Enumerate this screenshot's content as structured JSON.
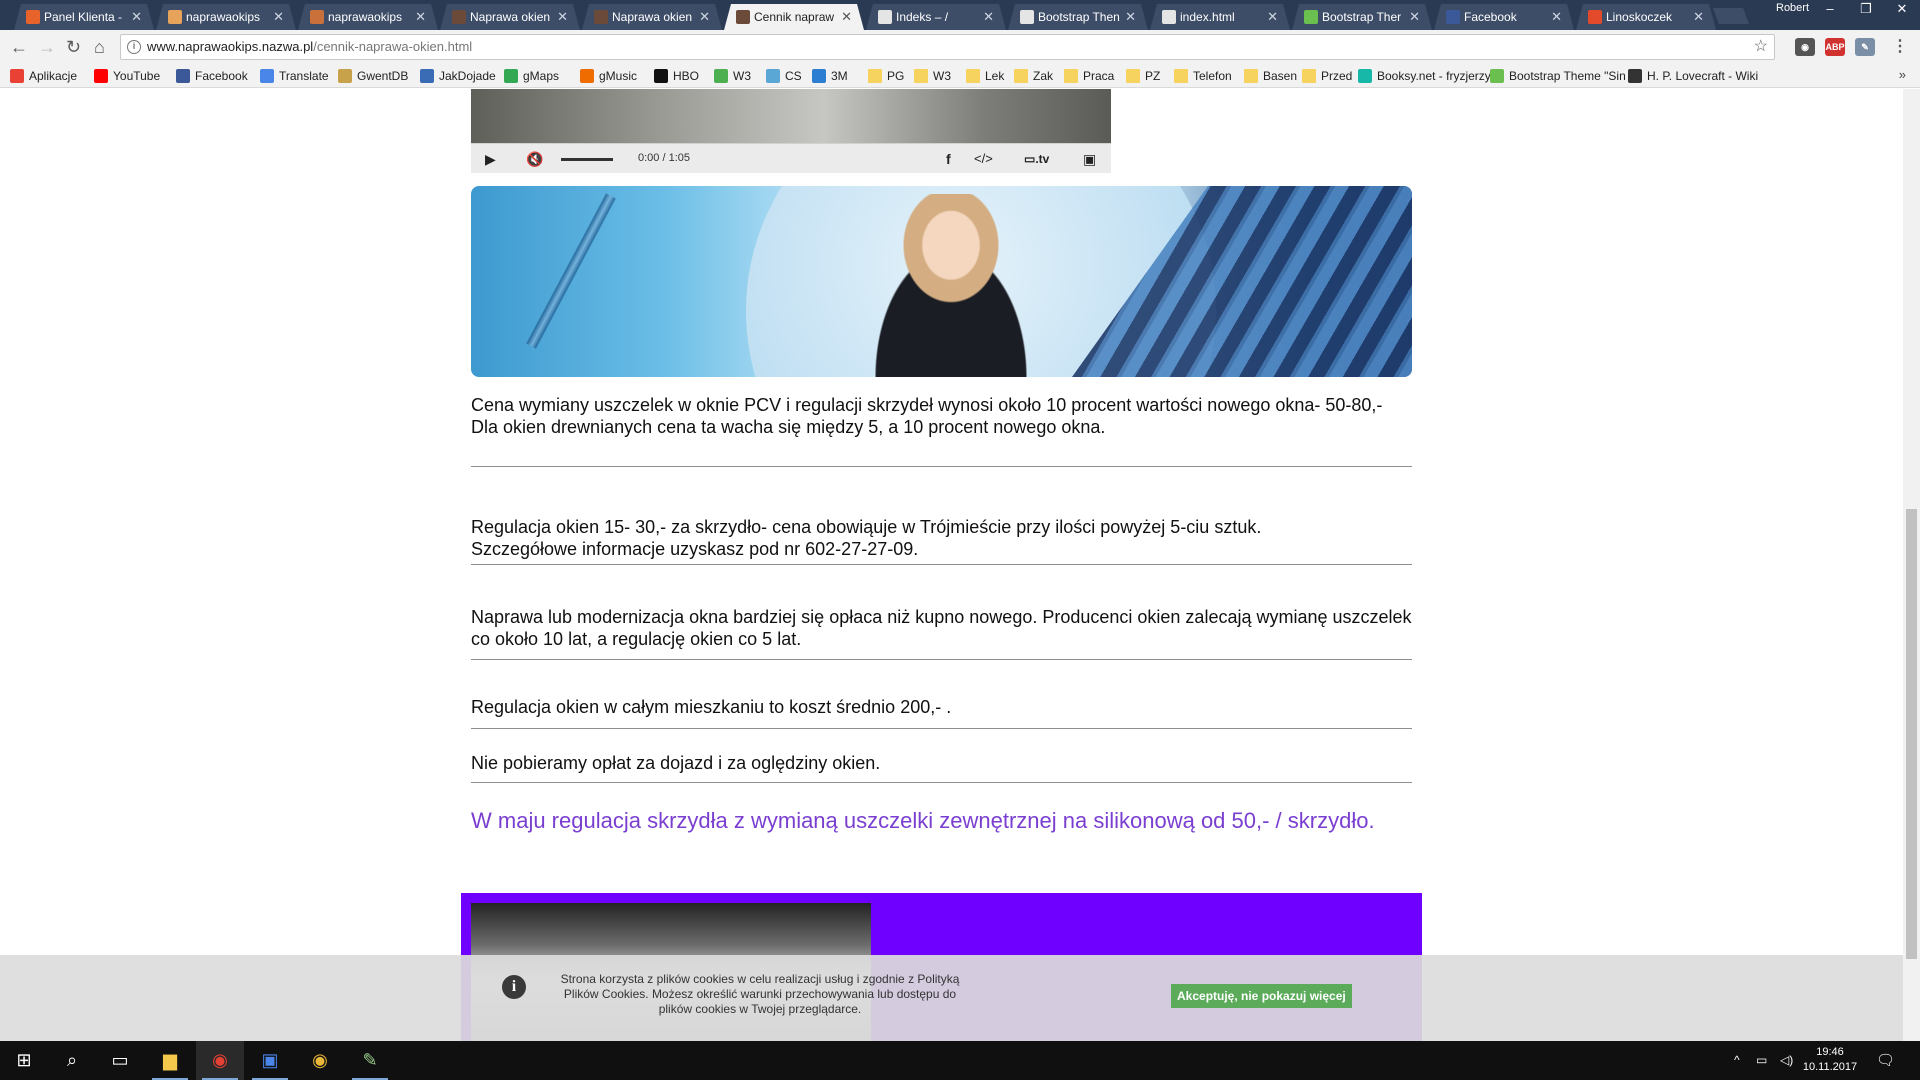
{
  "browser": {
    "tabs": [
      {
        "label": "Panel Klienta -",
        "color": "#e8632a"
      },
      {
        "label": "naprawaokips",
        "color": "#e8a35a"
      },
      {
        "label": "naprawaokips",
        "color": "#c9703b"
      },
      {
        "label": "Naprawa okien",
        "color": "#6b4a3a"
      },
      {
        "label": "Naprawa okien",
        "color": "#6b4a3a"
      },
      {
        "label": "Cennik napraw",
        "color": "#6b4a3a"
      },
      {
        "label": "Indeks – /",
        "color": "#e5e5e5"
      },
      {
        "label": "Bootstrap Then",
        "color": "#e5e5e5"
      },
      {
        "label": "index.html",
        "color": "#e5e5e5"
      },
      {
        "label": "Bootstrap Ther",
        "color": "#6bbf4e"
      },
      {
        "label": "Facebook",
        "color": "#3b5998"
      },
      {
        "label": "Linoskoczek",
        "color": "#e24a2b"
      }
    ],
    "active_tab_index": 5,
    "profile_name": "Robert",
    "url_host": "www.naprawaokips.nazwa.pl",
    "url_path": "/cennik-naprawa-okien.html",
    "bookmarks": [
      {
        "label": "Aplikacje",
        "icon": "apps-grid-icon",
        "color": "#e94235"
      },
      {
        "label": "YouTube",
        "icon": "youtube-icon",
        "color": "#ff0000"
      },
      {
        "label": "Facebook",
        "icon": "facebook-icon",
        "color": "#3b5998"
      },
      {
        "label": "Translate",
        "icon": "translate-icon",
        "color": "#4a86e8"
      },
      {
        "label": "GwentDB",
        "icon": "gwentdb-icon",
        "color": "#c8a24a"
      },
      {
        "label": "JakDojade",
        "icon": "jakdojade-icon",
        "color": "#3a6bb5"
      },
      {
        "label": "gMaps",
        "icon": "maps-icon",
        "color": "#34a853"
      },
      {
        "label": "gMusic",
        "icon": "music-icon",
        "color": "#ef6c00"
      },
      {
        "label": "HBO",
        "icon": "hbo-icon",
        "color": "#111111"
      },
      {
        "label": "W3",
        "icon": "w3-icon",
        "color": "#4caf50"
      },
      {
        "label": "CS",
        "icon": "cs-icon",
        "color": "#5aa7d6"
      },
      {
        "label": "3M",
        "icon": "3m-icon",
        "color": "#2d7dd2"
      },
      {
        "label": "PG",
        "icon": "folder-icon",
        "color": "#f6d35f"
      },
      {
        "label": "W3",
        "icon": "folder-icon",
        "color": "#f6d35f"
      },
      {
        "label": "Lek",
        "icon": "folder-icon",
        "color": "#f6d35f"
      },
      {
        "label": "Zak",
        "icon": "folder-icon",
        "color": "#f6d35f"
      },
      {
        "label": "Praca",
        "icon": "folder-icon",
        "color": "#f6d35f"
      },
      {
        "label": "PZ",
        "icon": "folder-icon",
        "color": "#f6d35f"
      },
      {
        "label": "Telefon",
        "icon": "folder-icon",
        "color": "#f6d35f"
      },
      {
        "label": "Basen",
        "icon": "folder-icon",
        "color": "#f6d35f"
      },
      {
        "label": "Przed",
        "icon": "folder-icon",
        "color": "#f6d35f"
      },
      {
        "label": "Booksy.net - fryzjerzy",
        "icon": "booksy-icon",
        "color": "#18b8a8"
      },
      {
        "label": "Bootstrap Theme \"Sin",
        "icon": "bootstrap-icon",
        "color": "#6bbf4e"
      },
      {
        "label": "H. P. Lovecraft - Wiki",
        "icon": "wikipedia-icon",
        "color": "#333333"
      }
    ]
  },
  "video": {
    "time": "0:00 / 1:05",
    "brand": ".tv"
  },
  "page": {
    "para1_line1": "Cena wymiany uszczelek w oknie PCV i regulacji skrzydeł wynosi około 10 procent wartości nowego okna- 50-80,-",
    "para1_line2": "Dla okien drewnianych cena ta wacha się między 5, a 10 procent nowego okna.",
    "para2_line1": "Regulacja okien 15- 30,- za skrzydło- cena obowiąuje w Trójmieście przy ilości powyżej 5-ciu sztuk.",
    "para2_line2": "Szczegółowe informacje uzyskasz pod nr 602-27-27-09.",
    "para3": "Naprawa lub modernizacja okna bardziej się opłaca niż kupno nowego. Producenci okien zalecają wymianę uszczelek co około 10 lat, a regulację okien co 5 lat.",
    "para4": "Regulacja okien w całym mieszkaniu to koszt średnio 200,- .",
    "para5": "Nie pobieramy opłat za dojazd i za oględziny okien.",
    "promo": "W maju regulacja skrzydła z wymianą uszczelki zewnętrznej na silikonową od 50,- / skrzydło."
  },
  "cookie": {
    "text": "Strona korzysta z plików cookies w celu realizacji usług i zgodnie z Polityką Plików Cookies. Możesz określić warunki przechowywania lub dostępu do plików cookies w Twojej przeglądarce.",
    "button": "Akceptuję, nie pokazuj więcej"
  },
  "taskbar": {
    "time": "19:46",
    "date": "10.11.2017"
  },
  "colors": {
    "accent_purple": "#7a3fd1",
    "box_purple": "#6f00ff",
    "cookie_button": "#5bab5b"
  }
}
